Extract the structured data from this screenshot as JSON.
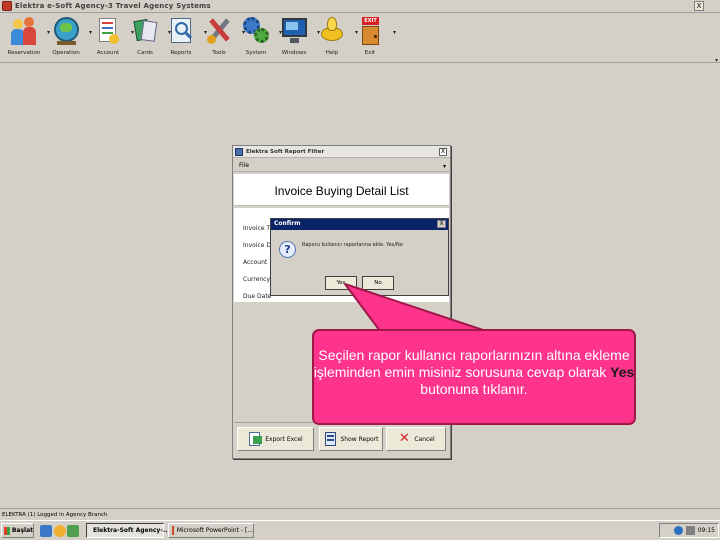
{
  "app": {
    "title": "Elektra e-Soft Agency-3 Travel Agency Systems",
    "close_glyph": "X"
  },
  "toolbar": {
    "items": [
      {
        "label": "Reservation",
        "icon": "people-icon"
      },
      {
        "label": "Operation",
        "icon": "globe-icon"
      },
      {
        "label": "Account",
        "icon": "account-icon"
      },
      {
        "label": "Cards",
        "icon": "cards-icon"
      },
      {
        "label": "Reports",
        "icon": "reports-icon"
      },
      {
        "label": "Tools",
        "icon": "tools-icon"
      },
      {
        "label": "System",
        "icon": "gears-icon"
      },
      {
        "label": "Windows",
        "icon": "monitor-icon"
      },
      {
        "label": "Help",
        "icon": "help-icon"
      },
      {
        "label": "Exit",
        "icon": "exit-door-icon"
      }
    ],
    "dropdown_glyph": "▾",
    "exit_sign": "EXIT"
  },
  "report_window": {
    "title": "Elektra Soft Report Filter",
    "menu_file": "File",
    "heading": "Invoice Buying Detail List",
    "fields": [
      "Invoice T",
      "Invoice D",
      "Account",
      "Currency",
      "Due Date"
    ],
    "buttons": {
      "export_excel": "Export Excel",
      "show_report": "Show Report",
      "cancel": "Cancel"
    }
  },
  "confirm_dialog": {
    "title": "Confirm",
    "message": "Raporu kullanıcı raporlarına ekle. Yes/No",
    "yes": "Yes",
    "no": "No",
    "icon_glyph": "?"
  },
  "callout": {
    "text_before": "Seçilen rapor kullanıcı raporlarınızın altına ekleme işleminden emin misiniz sorusuna cevap olarak ",
    "text_bold": "Yes",
    "text_after": " butonuna tıklanır."
  },
  "statusbar": {
    "text": "ELEKTRA (1) Logged in Agency Branch"
  },
  "taskbar": {
    "start_label": "Başlat",
    "tasks": [
      "Elektra-Soft Agency-...",
      "Microsoft PowerPoint - [..."
    ],
    "clock": "09:15"
  },
  "colors": {
    "callout_fill": "#fe348c",
    "callout_border": "#a01848",
    "dialog_title": "#0a246a",
    "chrome": "#d4d0c8"
  }
}
